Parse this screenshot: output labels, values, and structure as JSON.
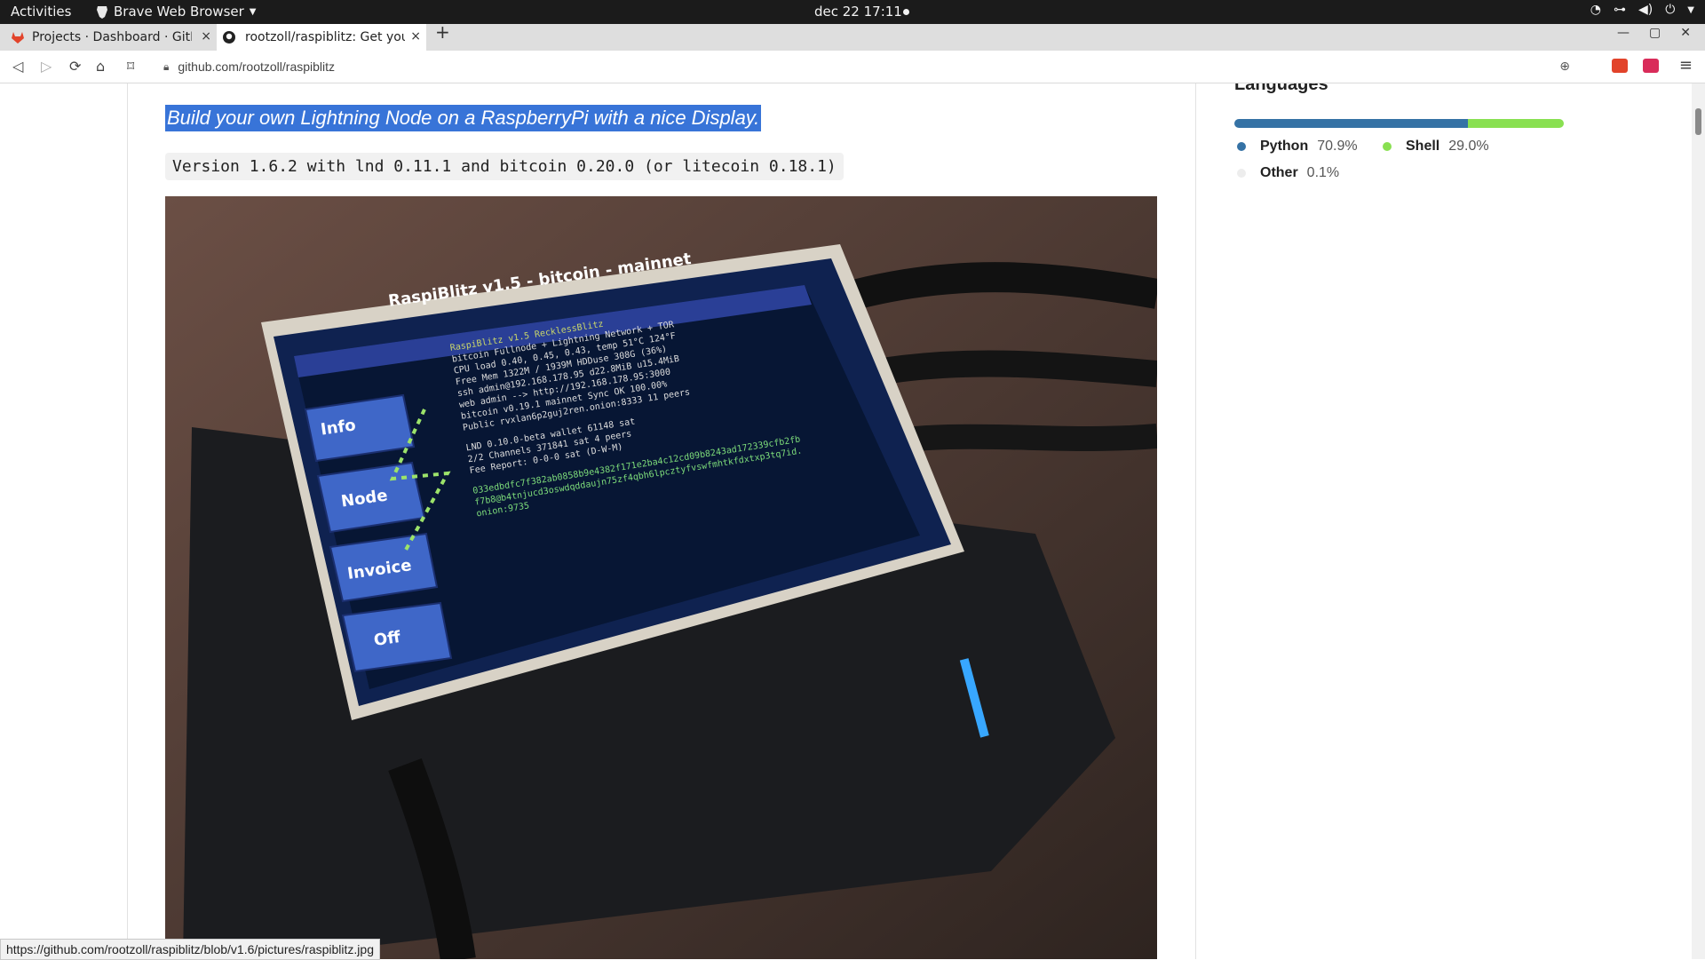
{
  "system_bar": {
    "activities": "Activities",
    "app_name": "Brave Web Browser",
    "clock": "dec 22  17:11"
  },
  "tabs": [
    {
      "title": "Projects · Dashboard · GitL",
      "close": "×"
    },
    {
      "title": "rootzoll/raspiblitz: Get you",
      "close": "×"
    }
  ],
  "new_tab": "+",
  "window_controls": {
    "minimize": "—",
    "restore": "▢",
    "close": "✕"
  },
  "toolbar": {
    "url": "github.com/rootzoll/raspiblitz",
    "back": "◁",
    "forward": "▷",
    "reload": "⟳",
    "home": "⌂",
    "bookmark": "⌑",
    "zoom": "⊕",
    "menu": "≡"
  },
  "readme": {
    "tagline": "Build your own Lightning Node on a RaspberryPi with a nice Display.",
    "version_line": "Version 1.6.2 with lnd 0.11.1 and bitcoin 0.20.0 (or litecoin 0.18.1)"
  },
  "photo": {
    "screen_title": "RaspiBlitz v1.5 - bitcoin - mainnet",
    "buttons": [
      "Info",
      "Node",
      "Invoice",
      "Off"
    ],
    "terminal_lines": [
      "RaspiBlitz v1.5  RecklessBlitz",
      "bitcoin Fullnode + Lightning Network + TOR",
      "CPU load 0.40, 0.45, 0.43, temp 51°C 124°F",
      "Free Mem 1322M / 1939M  HDDuse 308G (36%)",
      "ssh admin@192.168.178.95 d22.8MiB u15.4MiB",
      "web admin --> http://192.168.178.95:3000",
      "bitcoin v0.19.1 mainnet Sync OK 100.00%",
      "Public rvxlan6p2guj2ren.onion:8333 11 peers",
      "LND 0.10.0-beta wallet 61148 sat",
      "2/2 Channels 371841 sat 4 peers",
      "Fee Report: 0-0-0 sat (D-W-M)",
      "033edbdfc7f382ab0858b9e4382f171e2ba4c12cd09b8243ad172339cfb2fb",
      "f7b8@b4tnjucd3oswdqddaujn75zf4qbh6lpcztyfvswfmhtkfdxtxp3tq7id.",
      "onion:9735"
    ]
  },
  "languages": {
    "title": "Languages",
    "items": [
      {
        "name": "Python",
        "percent": "70.9%",
        "share": 70.9,
        "color": "#3572A5"
      },
      {
        "name": "Shell",
        "percent": "29.0%",
        "share": 29.0,
        "color": "#89e051"
      },
      {
        "name": "Other",
        "percent": "0.1%",
        "share": 0.1,
        "color": "#ededed"
      }
    ]
  },
  "status_url": "https://github.com/rootzoll/raspiblitz/blob/v1.6/pictures/raspiblitz.jpg"
}
